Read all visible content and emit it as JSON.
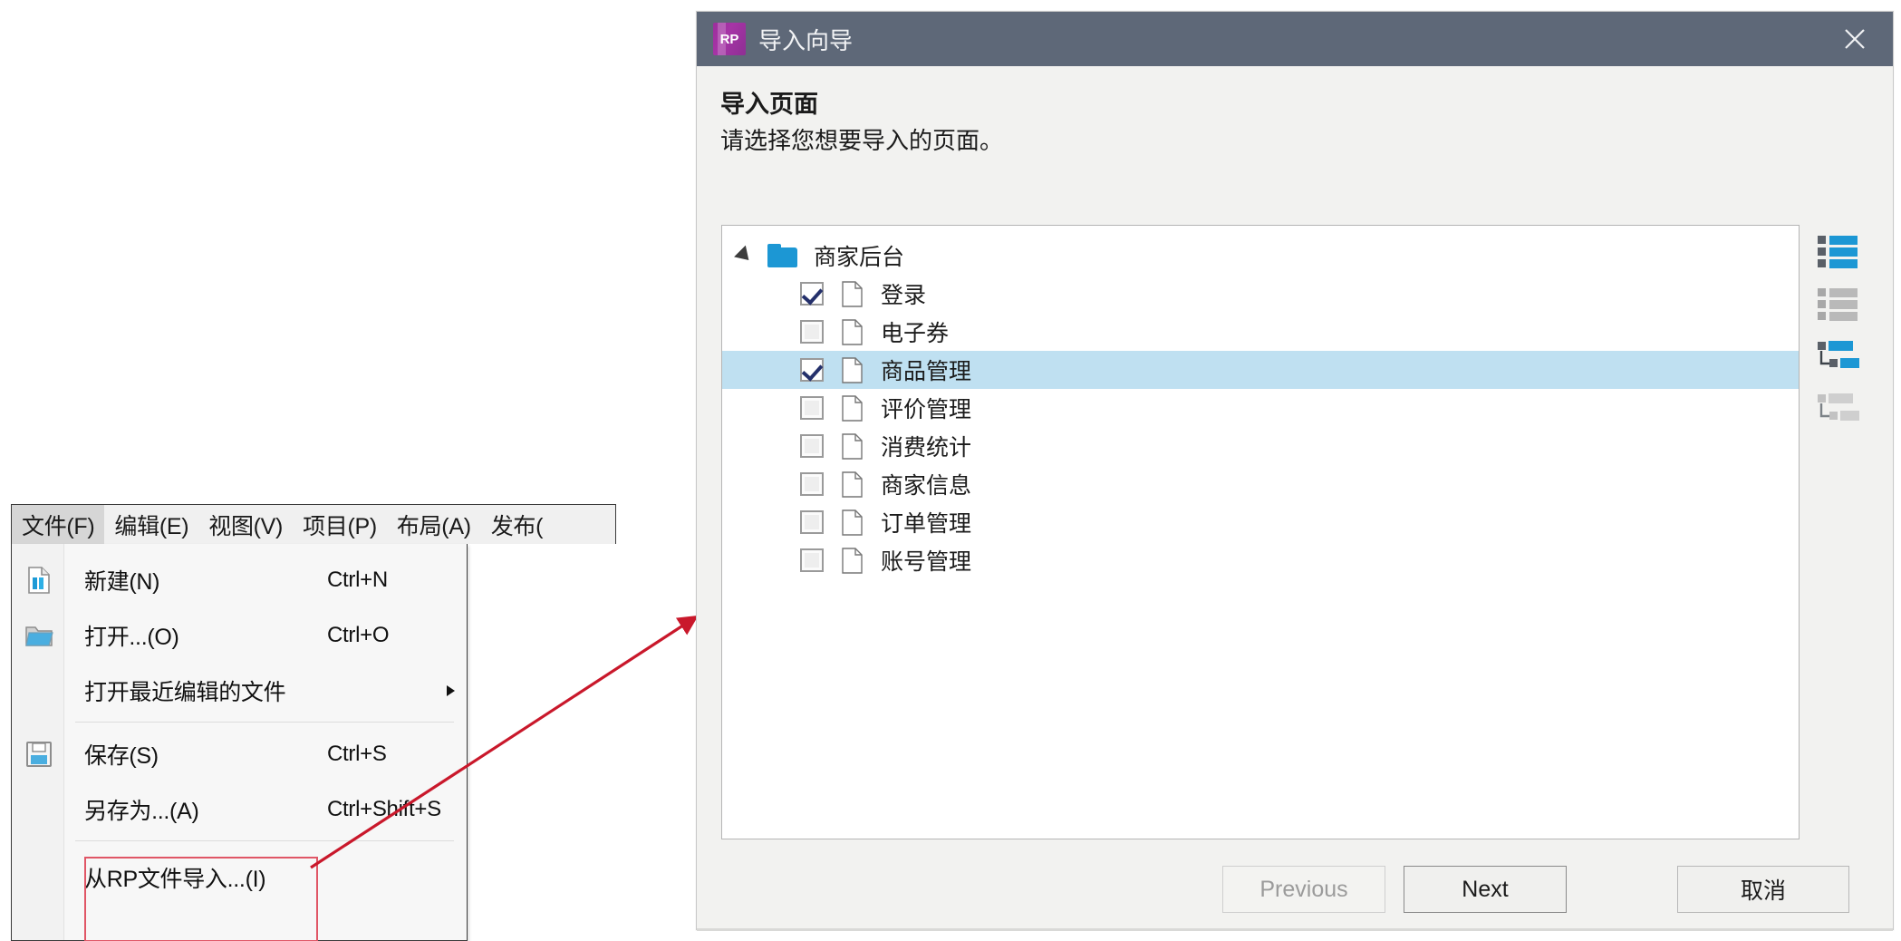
{
  "menu": {
    "bar_items": [
      {
        "label": "文件(F)",
        "active": true
      },
      {
        "label": "编辑(E)",
        "active": false
      },
      {
        "label": "视图(V)",
        "active": false
      },
      {
        "label": "项目(P)",
        "active": false
      },
      {
        "label": "布局(A)",
        "active": false
      },
      {
        "label": "发布(",
        "active": false
      }
    ],
    "items": [
      {
        "label": "新建(N)",
        "shortcut": "Ctrl+N",
        "icon": "new-document-icon",
        "submenu": false
      },
      {
        "label": "打开...(O)",
        "shortcut": "Ctrl+O",
        "icon": "open-folder-icon",
        "submenu": false
      },
      {
        "label": "打开最近编辑的文件",
        "shortcut": "",
        "icon": "",
        "submenu": true
      },
      {
        "label": "保存(S)",
        "shortcut": "Ctrl+S",
        "icon": "save-disk-icon",
        "submenu": false
      },
      {
        "label": "另存为...(A)",
        "shortcut": "Ctrl+Shift+S",
        "icon": "",
        "submenu": false
      },
      {
        "label": "从RP文件导入...(I)",
        "shortcut": "",
        "icon": "",
        "submenu": false
      }
    ]
  },
  "annotation": {
    "highlight_color": "#e05666",
    "arrow_color": "#c9182b"
  },
  "dialog": {
    "app_badge": "RP",
    "title": "导入向导",
    "close_label": "×",
    "heading": "导入页面",
    "subheading": "请选择您想要导入的页面。",
    "tree": {
      "root": {
        "label": "商家后台",
        "expanded": true
      },
      "items": [
        {
          "label": "登录",
          "checked": true,
          "selected": false
        },
        {
          "label": "电子券",
          "checked": false,
          "selected": false
        },
        {
          "label": "商品管理",
          "checked": true,
          "selected": true
        },
        {
          "label": "评价管理",
          "checked": false,
          "selected": false
        },
        {
          "label": "消费统计",
          "checked": false,
          "selected": false
        },
        {
          "label": "商家信息",
          "checked": false,
          "selected": false
        },
        {
          "label": "订单管理",
          "checked": false,
          "selected": false
        },
        {
          "label": "账号管理",
          "checked": false,
          "selected": false
        }
      ]
    },
    "tools": [
      {
        "name": "select-all-icon",
        "active": true
      },
      {
        "name": "deselect-all-icon",
        "active": false
      },
      {
        "name": "expand-all-icon",
        "active": true
      },
      {
        "name": "collapse-all-icon",
        "active": false
      }
    ],
    "buttons": {
      "previous": "Previous",
      "next": "Next",
      "cancel": "取消"
    }
  },
  "colors": {
    "titlebar": "#5e6878",
    "selection": "#bfe0f1",
    "accent_blue": "#1c97d4",
    "logo_purple": "#9c2f9c"
  }
}
